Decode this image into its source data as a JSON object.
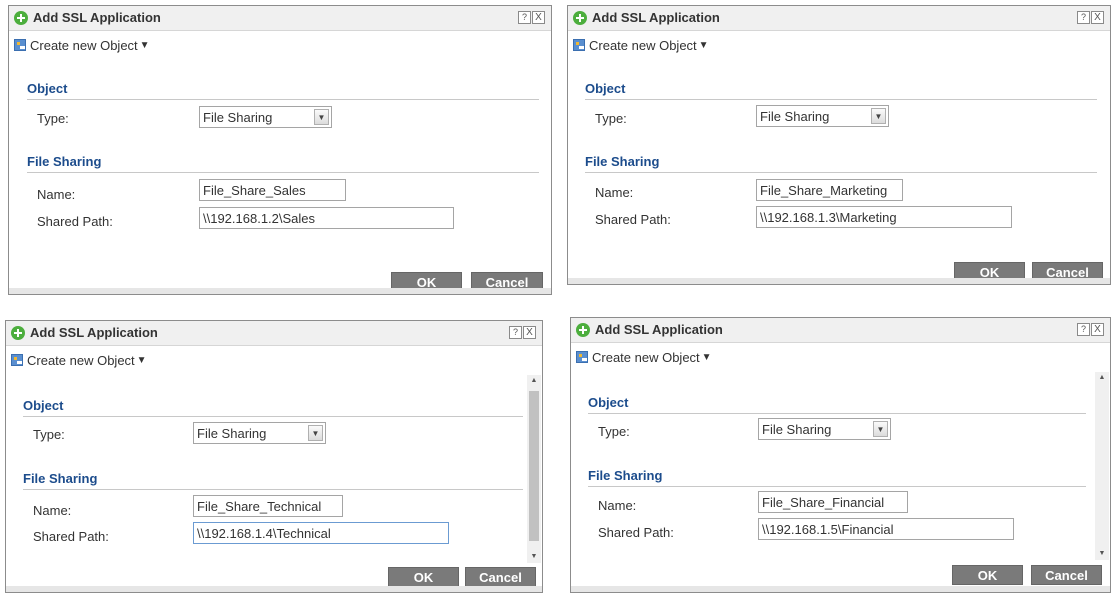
{
  "dialogs": [
    {
      "title": "Add SSL Application",
      "help_icon": "?",
      "close_icon": "X",
      "toolbar_label": "Create new Object",
      "toolbar_caret": "▼",
      "object_section": "Object",
      "type_label": "Type:",
      "type_value": "File Sharing",
      "file_sharing_section": "File Sharing",
      "name_label": "Name:",
      "name_value": "File_Share_Sales",
      "path_label": "Shared Path:",
      "path_value": "\\\\192.168.1.2\\Sales",
      "ok_label": "OK",
      "cancel_label": "Cancel"
    },
    {
      "title": "Add SSL Application",
      "help_icon": "?",
      "close_icon": "X",
      "toolbar_label": "Create new Object",
      "toolbar_caret": "▼",
      "object_section": "Object",
      "type_label": "Type:",
      "type_value": "File Sharing",
      "file_sharing_section": "File Sharing",
      "name_label": "Name:",
      "name_value": "File_Share_Marketing",
      "path_label": "Shared Path:",
      "path_value": "\\\\192.168.1.3\\Marketing",
      "ok_label": "OK",
      "cancel_label": "Cancel"
    },
    {
      "title": "Add SSL Application",
      "help_icon": "?",
      "close_icon": "X",
      "toolbar_label": "Create new Object",
      "toolbar_caret": "▼",
      "object_section": "Object",
      "type_label": "Type:",
      "type_value": "File Sharing",
      "file_sharing_section": "File Sharing",
      "name_label": "Name:",
      "name_value": "File_Share_Technical",
      "path_label": "Shared Path:",
      "path_value": "\\\\192.168.1.4\\Technical",
      "ok_label": "OK",
      "cancel_label": "Cancel"
    },
    {
      "title": "Add SSL Application",
      "help_icon": "?",
      "close_icon": "X",
      "toolbar_label": "Create new Object",
      "toolbar_caret": "▼",
      "object_section": "Object",
      "type_label": "Type:",
      "type_value": "File Sharing",
      "file_sharing_section": "File Sharing",
      "name_label": "Name:",
      "name_value": "File_Share_Financial",
      "path_label": "Shared Path:",
      "path_value": "\\\\192.168.1.5\\Financial",
      "ok_label": "OK",
      "cancel_label": "Cancel"
    }
  ],
  "colors": {
    "section_title": "#1c4c8c",
    "button_bg": "#7a7a7a",
    "add_icon": "#4cae3d"
  }
}
